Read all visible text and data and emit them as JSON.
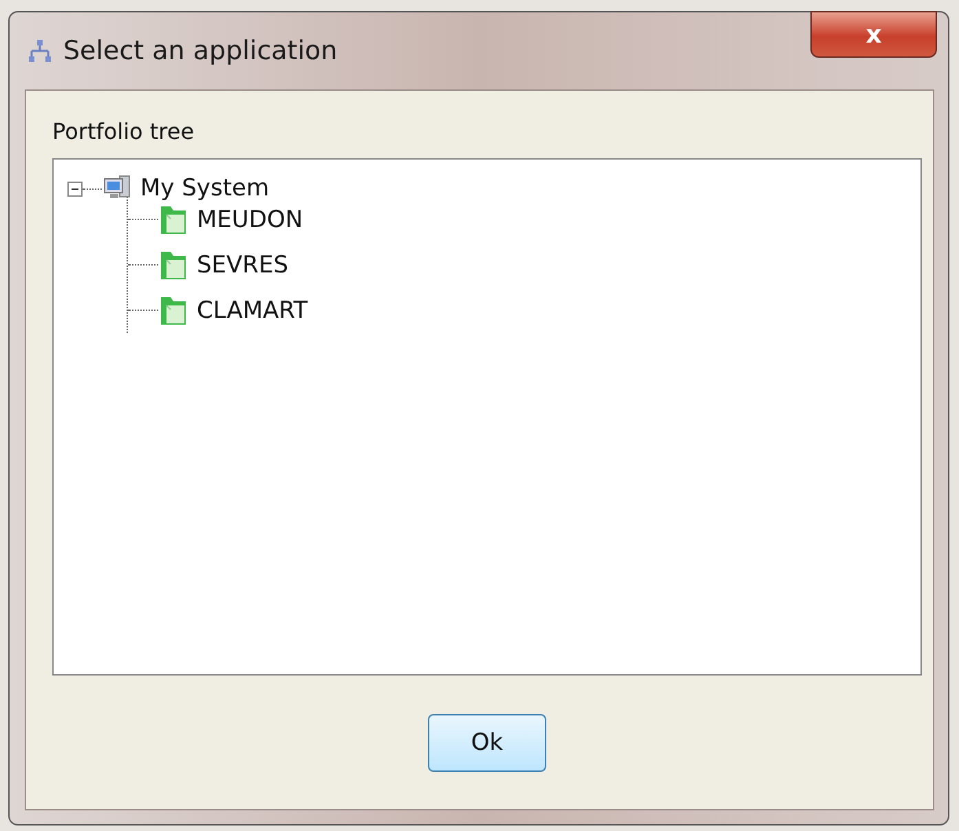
{
  "window": {
    "title": "Select an application",
    "close": "x"
  },
  "tree_label": "Portfolio tree",
  "tree": [
    {
      "label": "My System",
      "kind": "computer",
      "expanded": true,
      "children": [
        {
          "label": "MEUDON",
          "kind": "folder"
        },
        {
          "label": "SEVRES",
          "kind": "folder"
        },
        {
          "label": "CLAMART",
          "kind": "folder"
        }
      ]
    }
  ],
  "buttons": [
    "Ok"
  ]
}
